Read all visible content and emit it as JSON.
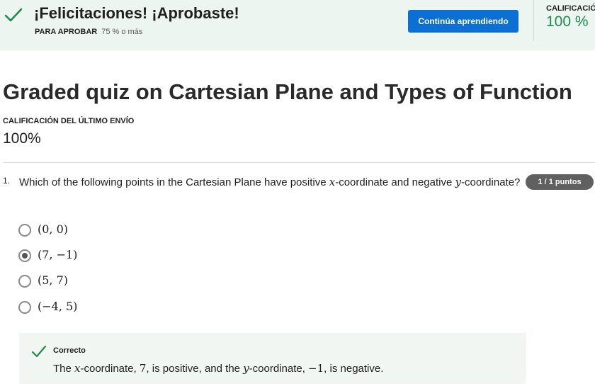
{
  "banner": {
    "title": "¡Felicitaciones! ¡Aprobaste!",
    "pass_label": "PARA APROBAR",
    "pass_value": "75 % o más",
    "continue_button": "Continúa aprendiendo",
    "grade_label": "CALIFICACIÓN",
    "grade_value": "100 %",
    "accent_color": "#1e8a4c",
    "button_color": "#0b6fd3"
  },
  "quiz": {
    "title": "Graded quiz on Cartesian Plane and Types of Function",
    "last_grade_label": "CALIFICACIÓN DEL ÚLTIMO ENVÍO",
    "last_grade_value": "100%"
  },
  "question": {
    "number": "1.",
    "text_parts": [
      "Which of the following points in the Cartesian Plane have positive ",
      "x",
      "-coordinate and negative ",
      "y",
      "-coordinate?"
    ],
    "points_badge": "1 / 1 puntos",
    "options": [
      {
        "label": "(0, 0)",
        "selected": false
      },
      {
        "label": "(7, −1)",
        "selected": true
      },
      {
        "label": "(5, 7)",
        "selected": false
      },
      {
        "label": "(−4, 5)",
        "selected": false
      }
    ]
  },
  "feedback": {
    "label": "Correcto",
    "text_parts": [
      "The ",
      "x",
      "-coordinate, ",
      "7",
      ", is positive, and the ",
      "y",
      "-coordinate, ",
      "−1",
      ", is negative."
    ]
  },
  "icons": {
    "banner_check": "check-icon",
    "feedback_check": "check-icon"
  }
}
